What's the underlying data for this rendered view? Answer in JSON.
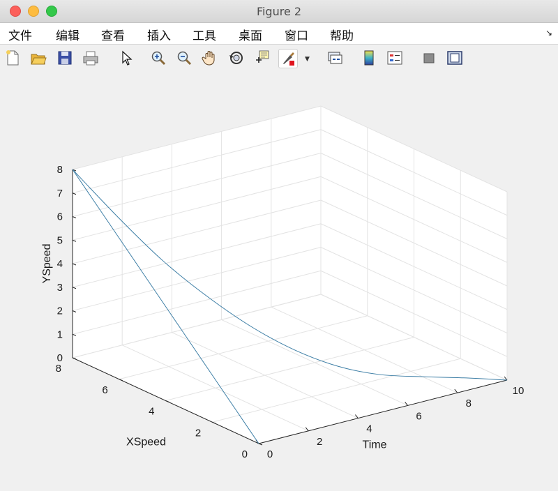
{
  "window": {
    "title": "Figure 2"
  },
  "menu": [
    "文件",
    "编辑",
    "查看",
    "插入",
    "工具",
    "桌面",
    "窗口",
    "帮助"
  ],
  "menu_corner_icon": "dock-arrow-icon",
  "toolbar": [
    "new-figure-icon",
    "open-file-icon",
    "save-icon",
    "print-icon",
    "pointer-icon",
    "zoom-in-icon",
    "zoom-out-icon",
    "pan-hand-icon",
    "rotate-3d-icon",
    "data-cursor-icon",
    "brush-icon",
    "link-plot-icon",
    "colorbar-icon",
    "legend-icon",
    "hide-plot-tools-icon",
    "show-plot-tools-icon"
  ],
  "colors": {
    "line": "#3e7fa6",
    "grid": "#e3e3e3",
    "axis": "#262626",
    "background": "#f0f0f0"
  },
  "chart_data": {
    "type": "line",
    "projection": "3d",
    "xlabel": "Time",
    "ylabel": "XSpeed",
    "zlabel": "YSpeed",
    "xlim": [
      0,
      10
    ],
    "ylim": [
      0,
      8
    ],
    "zlim": [
      0,
      8
    ],
    "xticks": [
      0,
      2,
      4,
      6,
      8,
      10
    ],
    "yticks": [
      0,
      2,
      4,
      6,
      8
    ],
    "zticks": [
      0,
      1,
      2,
      3,
      4,
      5,
      6,
      7,
      8
    ],
    "grid": true,
    "series": [
      {
        "time": [
          0,
          0,
          0,
          0,
          0,
          0,
          0,
          0,
          0
        ],
        "xspeed": [
          8,
          7,
          6,
          5,
          4,
          3,
          2,
          1,
          0
        ],
        "yspeed": [
          8,
          7,
          6,
          5,
          4,
          3,
          2,
          1,
          0
        ]
      },
      {
        "time": [
          0,
          1,
          2,
          3,
          4,
          5,
          6,
          7,
          8,
          9,
          10
        ],
        "xspeed": [
          8,
          7.1,
          6.3,
          5.5,
          4.6,
          3.8,
          3.0,
          2.3,
          1.5,
          0.8,
          0
        ],
        "yspeed": [
          8,
          6.1,
          4.4,
          3.0,
          1.8,
          0.9,
          0.3,
          0,
          0,
          0,
          0
        ]
      }
    ]
  }
}
